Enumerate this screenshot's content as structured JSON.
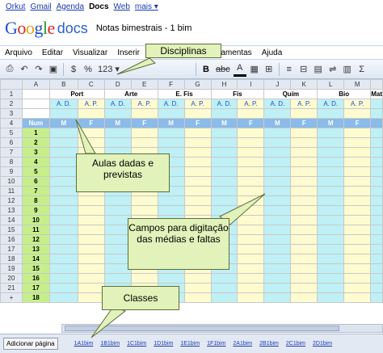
{
  "topbar": {
    "links": [
      "Orkut",
      "Gmail",
      "Agenda",
      "Docs",
      "Web",
      "mais ▾"
    ],
    "current": "Docs"
  },
  "header": {
    "logo": "Google",
    "product": "docs",
    "doc_title": "Notas bimestrais - 1 bim"
  },
  "menu": [
    "Arquivo",
    "Editar",
    "Visualizar",
    "Inserir",
    "Ferramentas",
    "Ajuda"
  ],
  "toolbar": {
    "currency": "$",
    "percent": "%",
    "number_format": "123 ▾",
    "bold": "B",
    "strike": "abc",
    "text_color": "A"
  },
  "grid": {
    "col_letters": [
      "A",
      "B",
      "C",
      "D",
      "E",
      "F",
      "G",
      "H",
      "I",
      "J",
      "K",
      "L",
      "M"
    ],
    "subjects": [
      "Port",
      "Arte",
      "E. Fís",
      "Fís",
      "Quím",
      "Bio",
      "Mat"
    ],
    "ap_labels": [
      "A. D.",
      "A. P.",
      "A. D.",
      "A. P.",
      "A. D.",
      "A. P.",
      "A. D.",
      "A. P.",
      "A. D.",
      "A. P.",
      "A. D.",
      "A. P."
    ],
    "num_header": "Num",
    "mf_labels": [
      "M",
      "F",
      "M",
      "F",
      "M",
      "F",
      "M",
      "F",
      "M",
      "F",
      "M",
      "F"
    ],
    "rows": [
      {
        "r": "1"
      },
      {
        "r": "2"
      },
      {
        "r": "3"
      },
      {
        "r": "4"
      },
      {
        "r": "5",
        "n": "1"
      },
      {
        "r": "6",
        "n": "2"
      },
      {
        "r": "7",
        "n": "3"
      },
      {
        "r": "8",
        "n": "4"
      },
      {
        "r": "9",
        "n": "5"
      },
      {
        "r": "10",
        "n": "6"
      },
      {
        "r": "11",
        "n": "7"
      },
      {
        "r": "12",
        "n": "8"
      },
      {
        "r": "13",
        "n": "9"
      },
      {
        "r": "14",
        "n": "10"
      },
      {
        "r": "15",
        "n": "11"
      },
      {
        "r": "16",
        "n": "12"
      },
      {
        "r": "17",
        "n": "13"
      },
      {
        "r": "18",
        "n": "14"
      },
      {
        "r": "19",
        "n": "15"
      },
      {
        "r": "20",
        "n": "16"
      },
      {
        "r": "21",
        "n": "17"
      },
      {
        "r": "+",
        "n": "18"
      }
    ]
  },
  "tabs": {
    "add_page": "Adicionar página",
    "sheets": [
      "1A1bim",
      "1B1bim",
      "1C1bim",
      "1D1bim",
      "1E1bim",
      "1F1bim",
      "2A1bim",
      "2B1bim",
      "2C1bim",
      "2D1bim"
    ]
  },
  "callouts": {
    "disciplinas": "Disciplinas",
    "aulas": "Aulas dadas e previstas",
    "campos": "Campos para digitação das médias e faltas",
    "classes": "Classes"
  },
  "colors": {
    "cyan": "#bef0f5",
    "yellow": "#fdfbcf",
    "green": "#c6ef8c",
    "blue": "#8bbbe9",
    "callout": "#e1f2ba"
  }
}
